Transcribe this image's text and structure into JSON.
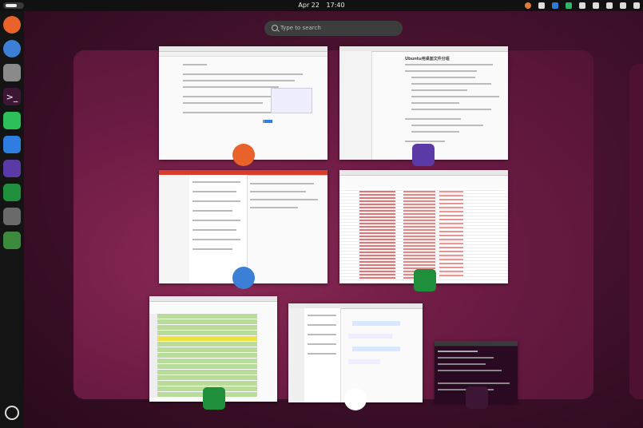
{
  "topbar": {
    "date": "Apr 22",
    "time": "17:40"
  },
  "search": {
    "placeholder": "Type to search"
  },
  "dock": {
    "apps": [
      {
        "name": "firefox-icon",
        "color": "#e8622a"
      },
      {
        "name": "thunderbird-icon",
        "color": "#3b7fd6"
      },
      {
        "name": "files-icon",
        "color": "#8a8a8a"
      },
      {
        "name": "terminal-icon",
        "color": "#3d1635"
      },
      {
        "name": "wechat-icon",
        "color": "#2dc05a"
      },
      {
        "name": "mail-icon",
        "color": "#2e7de0"
      },
      {
        "name": "obsidian-icon",
        "color": "#5b3aa8"
      },
      {
        "name": "spreadsheet-icon",
        "color": "#1f8f3b"
      },
      {
        "name": "usb-icon",
        "color": "#6a6a6a"
      },
      {
        "name": "trash-icon",
        "color": "#3c8a3c"
      }
    ],
    "apps_grid_icon": "apps-grid-icon"
  },
  "windows": {
    "browser": {
      "icon": "firefox-icon"
    },
    "notes": {
      "icon": "obsidian-icon",
      "heading": "Ubuntu用桌面文件分组"
    },
    "mail": {
      "icon": "thunderbird-icon"
    },
    "sheet1": {
      "icon": "spreadsheet-icon"
    },
    "sheet2": {
      "icon": "spreadsheet-icon"
    },
    "chat": {
      "icon": "mail-icon"
    },
    "terminal": {
      "icon": "terminal-icon"
    }
  }
}
